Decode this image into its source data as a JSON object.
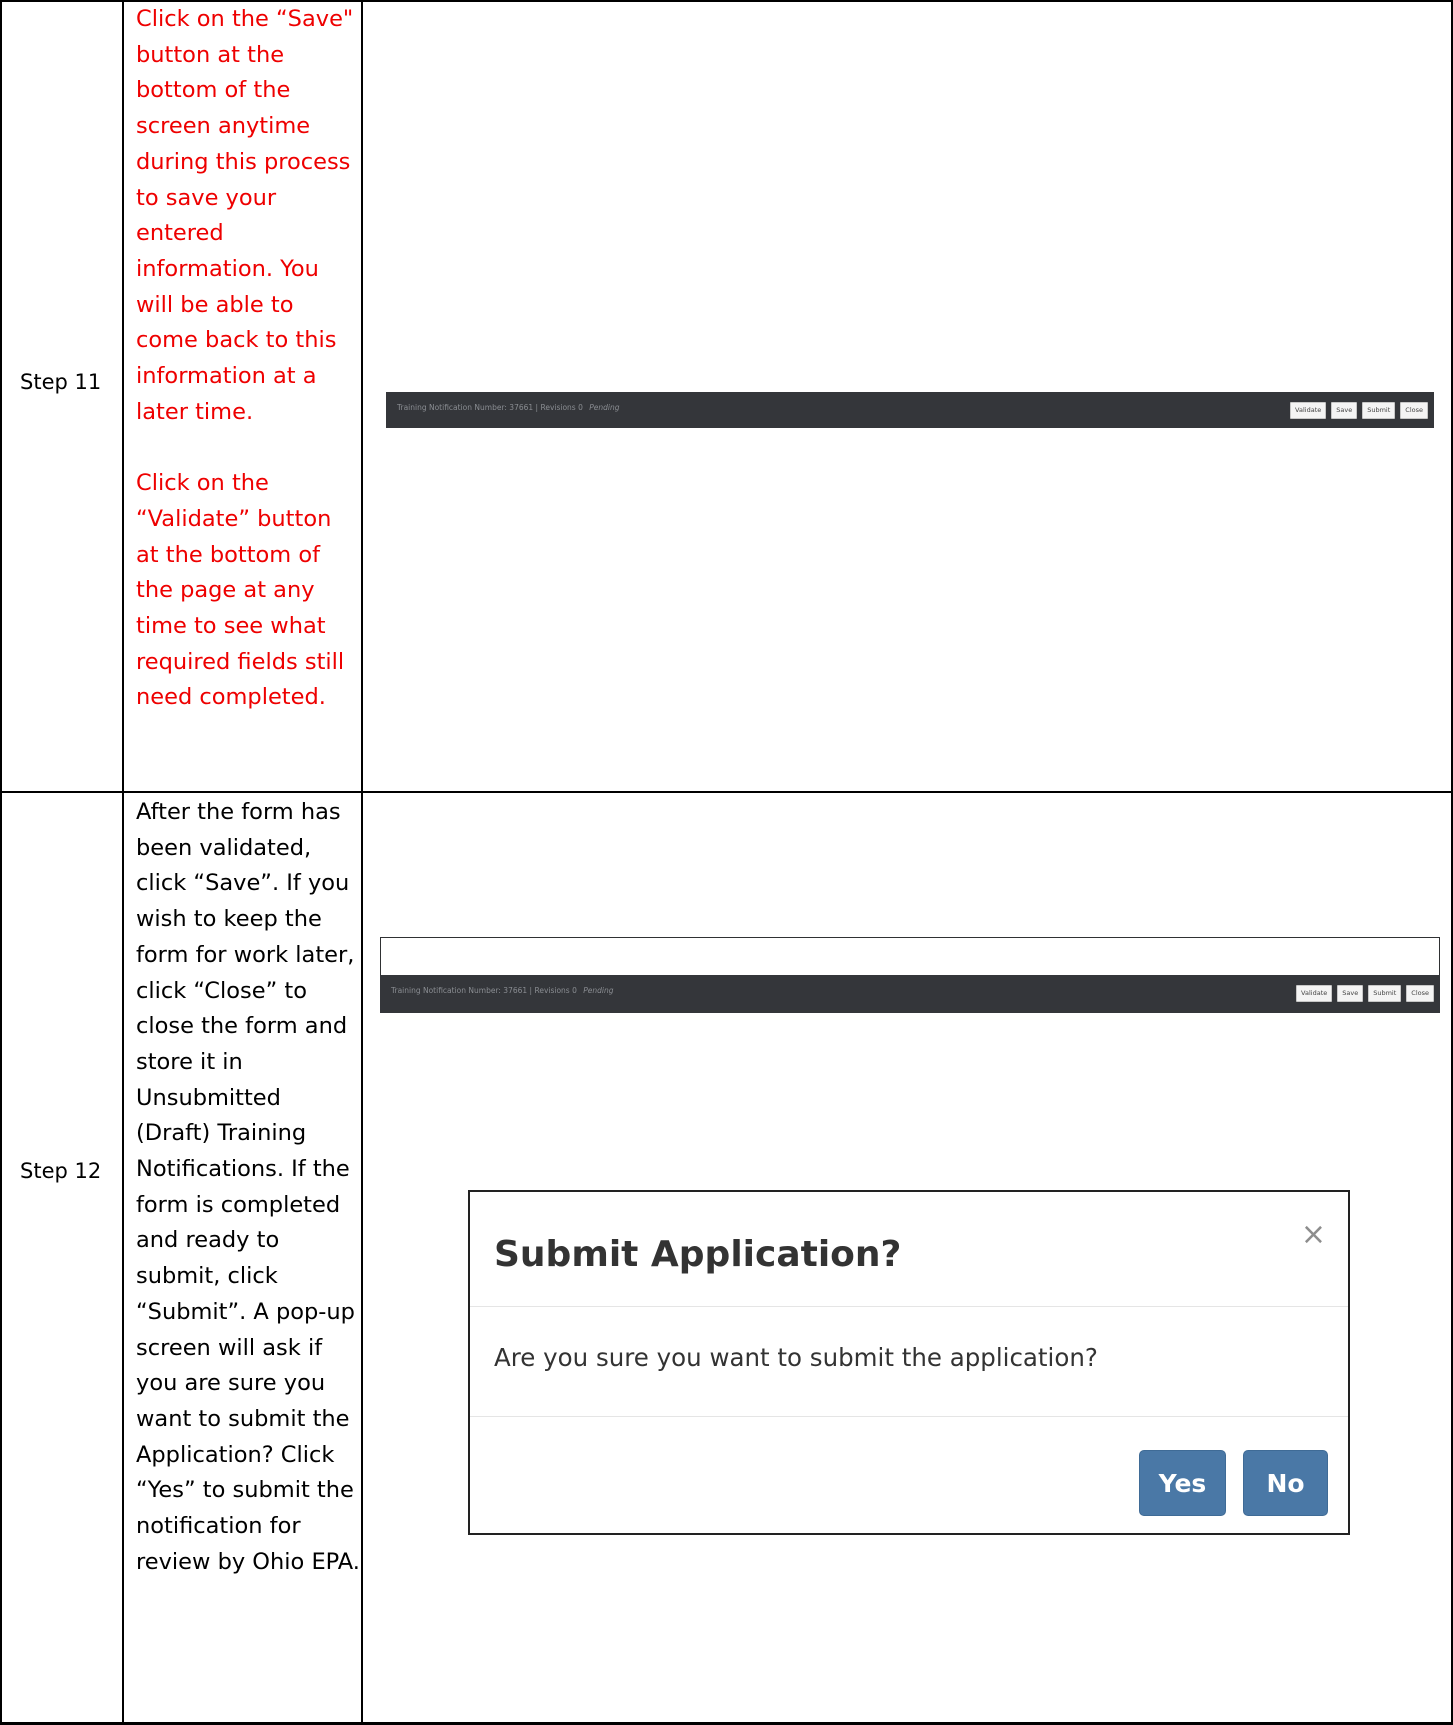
{
  "steps": [
    {
      "label": "Step 11",
      "instructions": [
        "Click on the “Save\" button at the bottom of the screen anytime during this process to save your entered information. You will be able to come back to this information at a later time.",
        "Click on the “Validate” button at the bottom of the page at any time to see what required fields still need completed."
      ],
      "screenshot": {
        "info_text": "Training Notification Number: 37661   | Revisions 0",
        "status": "Pending",
        "buttons": [
          "Validate",
          "Save",
          "Submit",
          "Close"
        ]
      }
    },
    {
      "label": "Step 12",
      "instructions": [
        "After the form has been validated, click “Save”. If you wish to keep the form for work later, click “Close” to close the form and store it in Unsubmitted (Draft) Training Notifications. If the form is completed and ready to submit, click “Submit”. A pop-up screen will ask if you are sure you want to submit the Application? Click “Yes” to submit the notification for review by Ohio EPA."
      ],
      "screenshot": {
        "info_text": "Training Notification Number: 37661   | Revisions 0",
        "status": "Pending",
        "buttons": [
          "Validate",
          "Save",
          "Submit",
          "Close"
        ]
      },
      "modal": {
        "title": "Submit Application?",
        "close_glyph": "×",
        "body": "Are you sure you want to submit the application?",
        "yes_label": "Yes",
        "no_label": "No"
      }
    }
  ],
  "colors": {
    "instruction_red": "#ee0000",
    "bar_dark": "#34363a",
    "modal_button": "#4a78a6"
  },
  "icons": [
    "close-icon"
  ]
}
